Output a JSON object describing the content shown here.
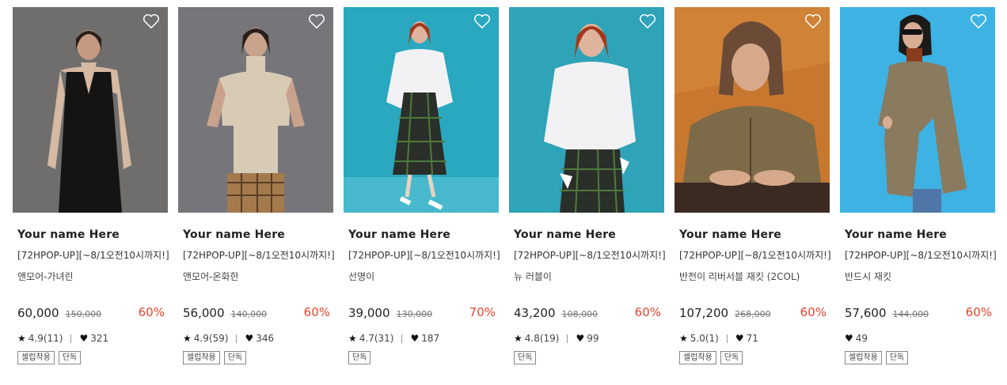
{
  "products": [
    {
      "brand": "Your name Here",
      "promo": "[72HPOP-UP][~8/1오전10시까지!]",
      "name": "앤모어-가녀린",
      "price": "60,000",
      "original_price": "150,000",
      "discount": "60%",
      "rating": "4.9(11)",
      "likes": "321",
      "tags": [
        "셀럽착용",
        "단독"
      ],
      "photo_bg": "#6f6e6c"
    },
    {
      "brand": "Your name Here",
      "promo": "[72HPOP-UP][~8/1오전10시까지!]",
      "name": "앤모어-온화한",
      "price": "56,000",
      "original_price": "140,000",
      "discount": "60%",
      "rating": "4.9(59)",
      "likes": "346",
      "tags": [
        "셀럽착용",
        "단독"
      ],
      "photo_bg": "#76757a"
    },
    {
      "brand": "Your name Here",
      "promo": "[72HPOP-UP][~8/1오전10시까지!]",
      "name": "선명이",
      "price": "39,000",
      "original_price": "130,000",
      "discount": "70%",
      "rating": "4.7(31)",
      "likes": "187",
      "tags": [
        "단독"
      ],
      "photo_bg": "#2aa8bf"
    },
    {
      "brand": "Your name Here",
      "promo": "[72HPOP-UP][~8/1오전10시까지!]",
      "name": "뉴 러블이",
      "price": "43,200",
      "original_price": "108,000",
      "discount": "60%",
      "rating": "4.8(19)",
      "likes": "99",
      "tags": [
        "단독"
      ],
      "photo_bg": "#2fa3b8"
    },
    {
      "brand": "Your name Here",
      "promo": "[72HPOP-UP][~8/1오전10시까지!]",
      "name": "반전이 리버서블 재킷 (2COL)",
      "price": "107,200",
      "original_price": "268,000",
      "discount": "60%",
      "rating": "5.0(1)",
      "likes": "71",
      "tags": [
        "셀럽착용",
        "단독"
      ],
      "photo_bg": "#c8772e"
    },
    {
      "brand": "Your name Here",
      "promo": "[72HPOP-UP][~8/1오전10시까지!]",
      "name": "반드시 재킷",
      "price": "57,600",
      "original_price": "144,000",
      "discount": "60%",
      "rating": "",
      "likes": "49",
      "tags": [
        "셀럽착용",
        "단독"
      ],
      "photo_bg": "#3db2e3"
    }
  ],
  "colors": {
    "discount": "#e8442c",
    "text": "#222222"
  },
  "icons": {
    "wishlist": "heart-outline-icon",
    "rating": "star-icon",
    "likes": "heart-filled-icon"
  }
}
